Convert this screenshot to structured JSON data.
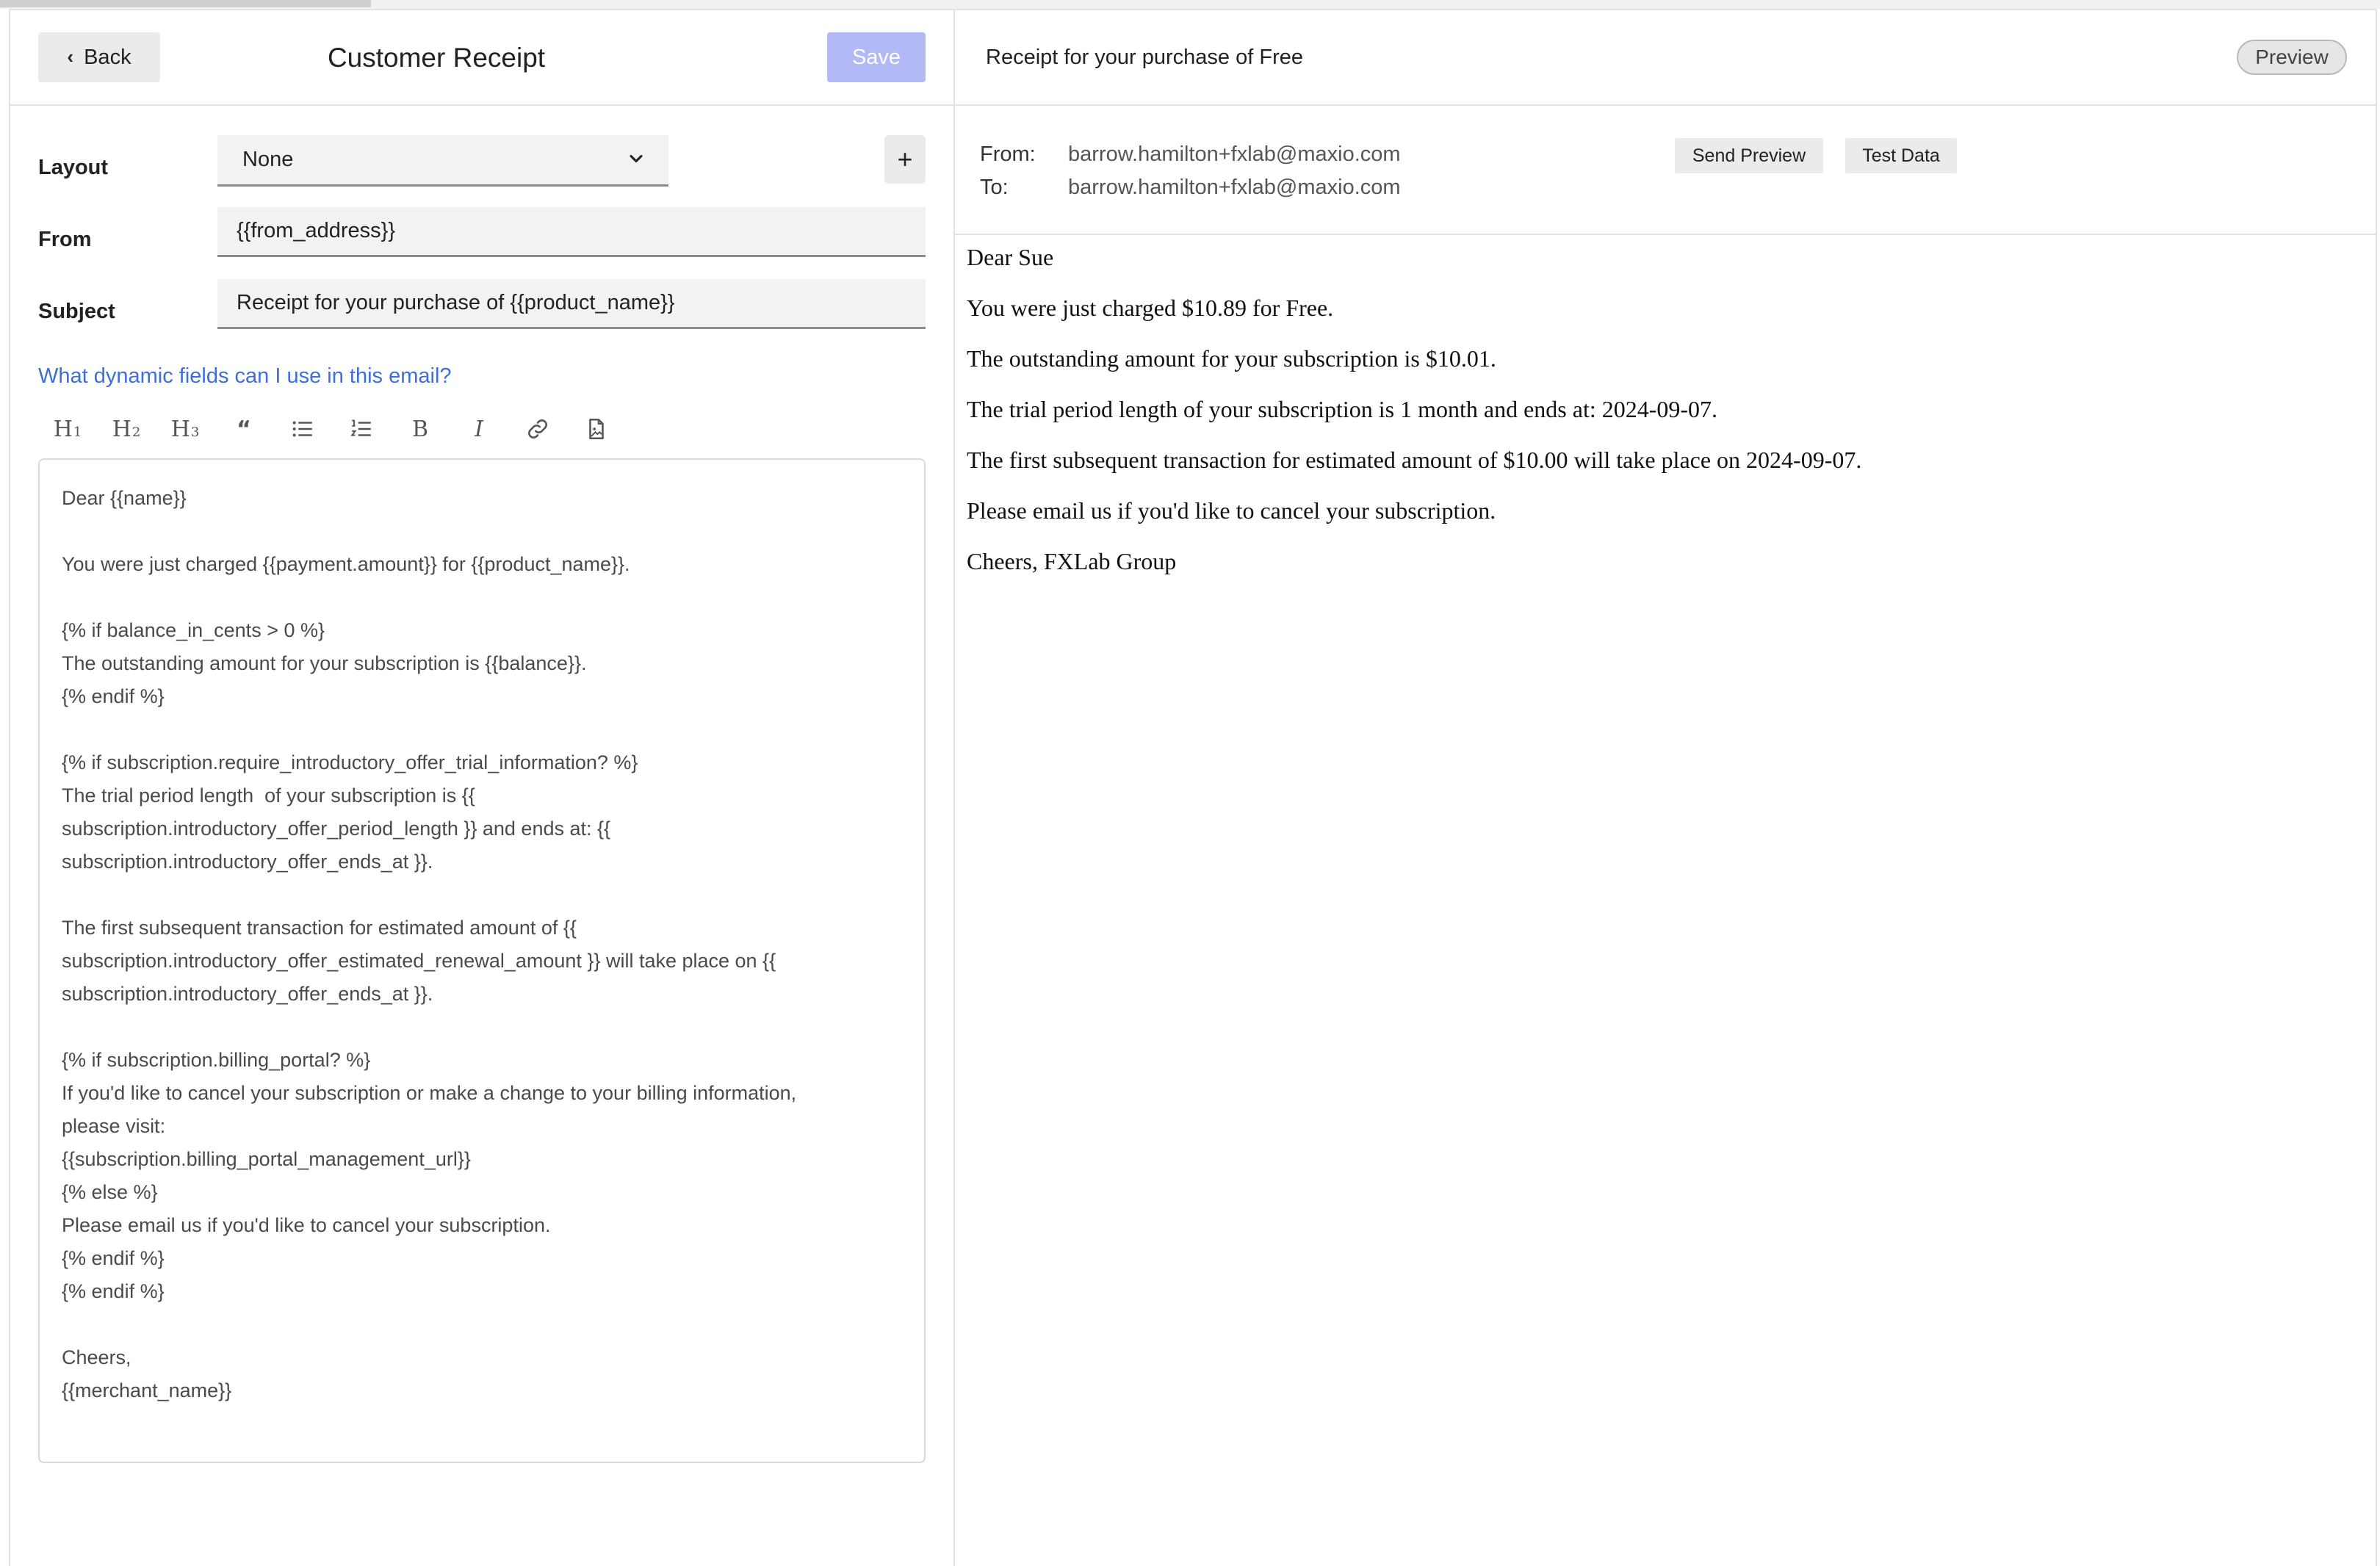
{
  "editor_header": {
    "back_label": "Back",
    "title": "Customer Receipt",
    "save_label": "Save"
  },
  "form": {
    "layout": {
      "label": "Layout",
      "value": "None"
    },
    "from": {
      "label": "From",
      "value": "{{from_address}}"
    },
    "subject": {
      "label": "Subject",
      "value": "Receipt for your purchase of {{product_name}}"
    },
    "add_label": "+",
    "help_link": "What dynamic fields can I use in this email?"
  },
  "toolbar": {
    "items": [
      "heading-1",
      "heading-2",
      "heading-3",
      "blockquote",
      "bulleted-list",
      "numbered-list",
      "bold",
      "italic",
      "link",
      "insert-file"
    ]
  },
  "editor": {
    "body": "Dear {{name}}\n\nYou were just charged {{payment.amount}} for {{product_name}}.\n\n{% if balance_in_cents > 0 %}\nThe outstanding amount for your subscription is {{balance}}.\n{% endif %}\n\n{% if subscription.require_introductory_offer_trial_information? %}\nThe trial period length  of your subscription is {{\nsubscription.introductory_offer_period_length }} and ends at: {{\nsubscription.introductory_offer_ends_at }}.\n\nThe first subsequent transaction for estimated amount of {{\nsubscription.introductory_offer_estimated_renewal_amount }} will take place on {{\nsubscription.introductory_offer_ends_at }}.\n\n{% if subscription.billing_portal? %}\nIf you'd like to cancel your subscription or make a change to your billing information,\nplease visit:\n{{subscription.billing_portal_management_url}}\n{% else %}\nPlease email us if you'd like to cancel your subscription.\n{% endif %}\n{% endif %}\n\nCheers,\n{{merchant_name}}"
  },
  "preview": {
    "subject": "Receipt for your purchase of Free",
    "badge": "Preview",
    "from_label": "From:",
    "from_value": "barrow.hamilton+fxlab@maxio.com",
    "to_label": "To:",
    "to_value": "barrow.hamilton+fxlab@maxio.com",
    "send_preview_label": "Send Preview",
    "test_data_label": "Test Data",
    "body": [
      "Dear Sue",
      "You were just charged $10.89 for Free.",
      "The outstanding amount for your subscription is $10.01.",
      "The trial period length of your subscription is 1 month and ends at: 2024-09-07.",
      "The first subsequent transaction for estimated amount of $10.00 will take place on 2024-09-07.",
      "Please email us if you'd like to cancel your subscription.",
      "Cheers, FXLab Group"
    ]
  },
  "colors": {
    "accent_link": "#3e6fd6",
    "save_disabled": "#b3b8f6"
  }
}
